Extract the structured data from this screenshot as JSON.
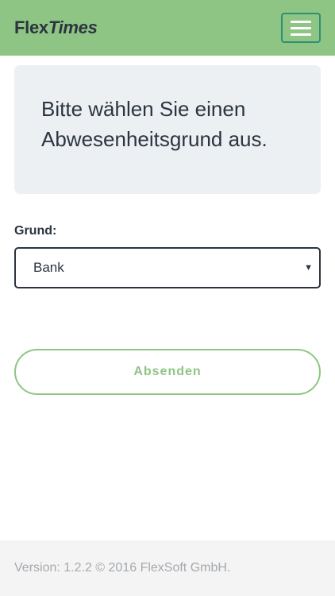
{
  "header": {
    "brand_prefix": "Flex",
    "brand_suffix": "Times",
    "menu_icon": "hamburger-menu-icon"
  },
  "info": {
    "message": "Bitte wählen Sie einen Abwesenheitsgrund aus."
  },
  "form": {
    "reason_label": "Grund:",
    "reason_value": "Bank",
    "caret": "▼",
    "submit_label": "Absenden"
  },
  "footer": {
    "text": "Version: 1.2.2 © 2016 FlexSoft GmbH."
  },
  "colors": {
    "navbar": "#8ec584",
    "accent_button_border": "#8ec584",
    "menu_button_border": "#2f8f73",
    "text": "#2b3440",
    "info_box": "#edf0f2",
    "footer_bg": "#f4f4f4",
    "footer_text": "#a5a9ad"
  }
}
